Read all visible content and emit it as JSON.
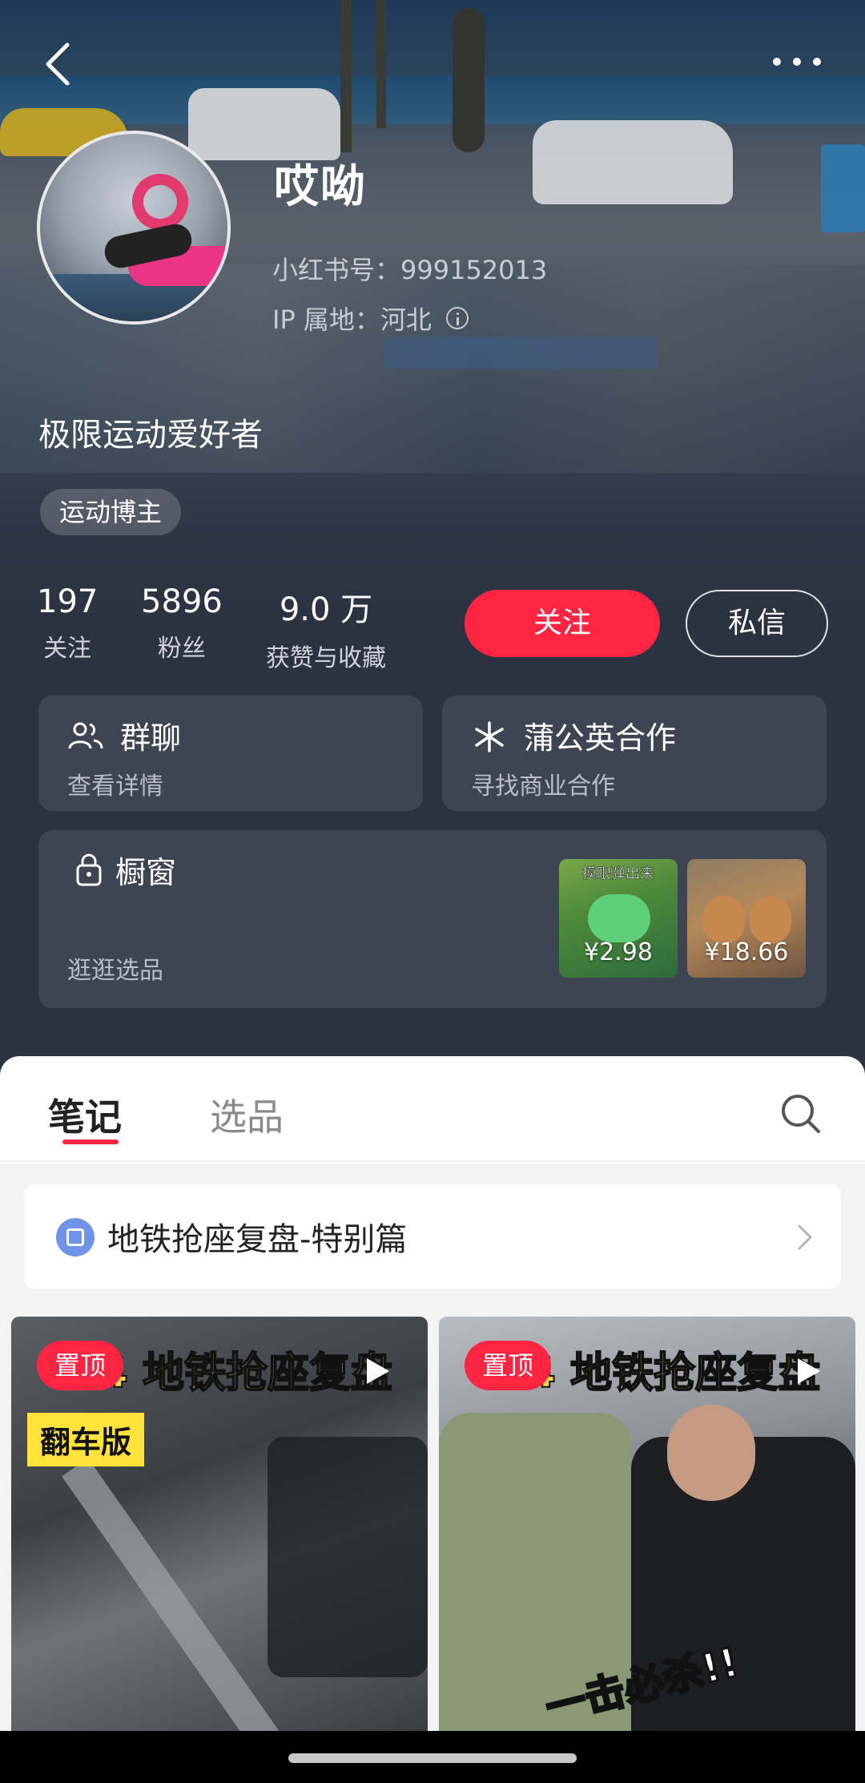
{
  "header": {
    "nickname": "哎呦",
    "red_id": "小红书号：999152013",
    "ip_location": "IP 属地：河北",
    "bio": "极限运动爱好者",
    "tag": "运动博主"
  },
  "stats": [
    {
      "value": "197",
      "label": "关注"
    },
    {
      "value": "5896",
      "label": "粉丝"
    },
    {
      "value": "9.0 万",
      "label": "获赞与收藏"
    }
  ],
  "actions": {
    "follow": "关注",
    "message": "私信"
  },
  "cards": {
    "group_chat": {
      "title": "群聊",
      "subtitle": "查看详情"
    },
    "dandelion": {
      "title": "蒲公英合作",
      "subtitle": "寻找商业合作"
    },
    "shop": {
      "title": "橱窗",
      "subtitle": "逛逛选品",
      "items": [
        {
          "price": "¥2.98",
          "caption": "摸眼弹出来"
        },
        {
          "price": "¥18.66"
        }
      ]
    }
  },
  "tabs": {
    "notes": "笔记",
    "products": "选品"
  },
  "collection": {
    "title": "地铁抢座复盘-特别篇"
  },
  "notes": [
    {
      "pin": "置顶",
      "title": "4 地铁抢座复盘",
      "badge": "翻车版"
    },
    {
      "pin": "置顶",
      "title": "1 4 地铁抢座复盘",
      "sticker": "一击必杀!!"
    }
  ],
  "colors": {
    "accent": "#ff2442",
    "bg_dark": "#2b3341",
    "card_dark": "rgba(255,255,255,0.09)"
  }
}
